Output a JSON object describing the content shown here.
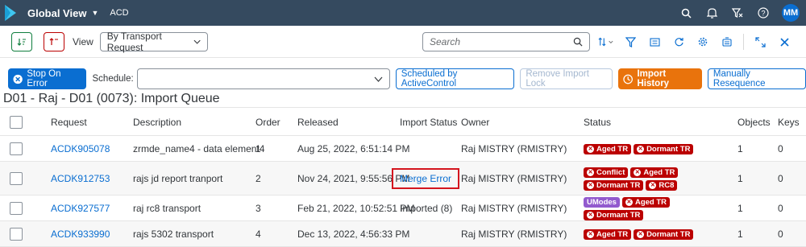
{
  "shell": {
    "title": "Global View",
    "subtitle": "ACD",
    "avatar": "MM"
  },
  "toolbar": {
    "view_label": "View",
    "view_value": "By Transport Request",
    "search_placeholder": "Search"
  },
  "actions": {
    "stop_on_error": "Stop On Error",
    "schedule_label": "Schedule:",
    "scheduled_by": "Scheduled by ActiveControl",
    "remove_lock": "Remove Import Lock",
    "import_history": "Import History",
    "manually_resequence": "Manually Resequence"
  },
  "page_title": "D01 - Raj - D01 (0073): Import Queue",
  "table": {
    "headers": {
      "request": "Request",
      "description": "Description",
      "order": "Order",
      "released": "Released",
      "import_status": "Import Status",
      "owner": "Owner",
      "status": "Status",
      "objects": "Objects",
      "keys": "Keys"
    },
    "rows": [
      {
        "request": "ACDK905078",
        "description": "zrmde_name4 - data element4",
        "order": "1",
        "released": "Aug 25, 2022, 6:51:14 PM",
        "import_status": "",
        "owner": "Raj MISTRY (RMISTRY)",
        "tags": [
          {
            "label": "Aged TR",
            "color": "#bb0000"
          },
          {
            "label": "Dormant TR",
            "color": "#bb0000"
          }
        ],
        "objects": "1",
        "keys": "0"
      },
      {
        "request": "ACDK912753",
        "description": "rajs jd report tranport",
        "order": "2",
        "released": "Nov 24, 2021, 9:55:56 PM",
        "import_status": "Merge Error",
        "owner": "Raj MISTRY (RMISTRY)",
        "tags": [
          {
            "label": "Conflict",
            "color": "#bb0000"
          },
          {
            "label": "Aged TR",
            "color": "#bb0000"
          },
          {
            "label": "Dormant TR",
            "color": "#bb0000"
          },
          {
            "label": "RC8",
            "color": "#bb0000"
          }
        ],
        "objects": "1",
        "keys": "0"
      },
      {
        "request": "ACDK927577",
        "description": "raj rc8 transport",
        "order": "3",
        "released": "Feb 21, 2022, 10:52:51 PM",
        "import_status": "Imported (8)",
        "owner": "Raj MISTRY (RMISTRY)",
        "tags": [
          {
            "label": "UModes",
            "color": "#925ace"
          },
          {
            "label": "Aged TR",
            "color": "#bb0000"
          },
          {
            "label": "Dormant TR",
            "color": "#bb0000"
          }
        ],
        "objects": "1",
        "keys": "0"
      },
      {
        "request": "ACDK933990",
        "description": "rajs 5302 transport",
        "order": "4",
        "released": "Dec 13, 2022, 4:56:33 PM",
        "import_status": "",
        "owner": "Raj MISTRY (RMISTRY)",
        "tags": [
          {
            "label": "Aged TR",
            "color": "#bb0000"
          },
          {
            "label": "Dormant TR",
            "color": "#bb0000"
          }
        ],
        "objects": "1",
        "keys": "0"
      }
    ]
  }
}
